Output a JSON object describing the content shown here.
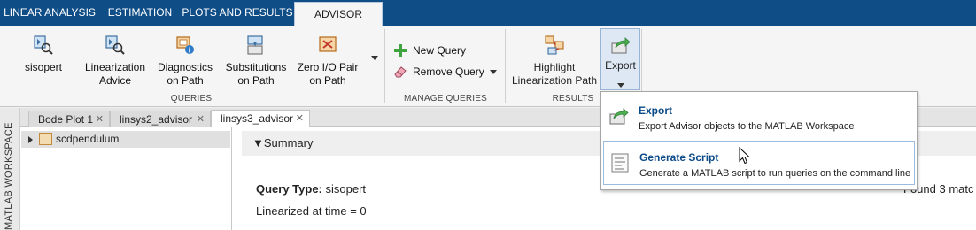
{
  "tabs": [
    "LINEAR ANALYSIS",
    "ESTIMATION",
    "PLOTS AND RESULTS",
    "ADVISOR"
  ],
  "ribbon": {
    "queries": {
      "label": "QUERIES",
      "buttons": [
        {
          "label": "sisopert",
          "icon": "block-query-icon"
        },
        {
          "label": "Linearization Advice",
          "icon": "block-query-icon"
        },
        {
          "label": "Diagnostics on Path",
          "icon": "diagnostics-icon"
        },
        {
          "label": "Substitutions on Path",
          "icon": "substitution-icon"
        },
        {
          "label": "Zero I/O Pair on Path",
          "icon": "zero-io-icon"
        }
      ]
    },
    "manage": {
      "label": "MANAGE QUERIES",
      "new_query": "New Query",
      "remove_query": "Remove Query"
    },
    "results": {
      "label": "RESULTS",
      "highlight": "Highlight Linearization Path",
      "export": "Export"
    }
  },
  "side_label": "MATLAB WORKSPACE",
  "doc_tabs": [
    "Bode Plot 1",
    "linsys2_advisor",
    "linsys3_advisor"
  ],
  "tree": {
    "root": "scdpendulum"
  },
  "summary": {
    "header": "▼Summary",
    "query_type_label": "Query Type:",
    "query_type_value": " sisopert",
    "linearized_at": "Linearized at time = 0",
    "found": "Found 3 matc"
  },
  "export_menu": [
    {
      "title": "Export",
      "desc": "Export Advisor objects to the MATLAB Workspace"
    },
    {
      "title": "Generate Script",
      "desc": "Generate a MATLAB script to run queries on the command line"
    }
  ],
  "colors": {
    "tabstrip": "#0f4d87",
    "accent_text": "#0b4a87",
    "export_hover": "#dde8f4"
  }
}
